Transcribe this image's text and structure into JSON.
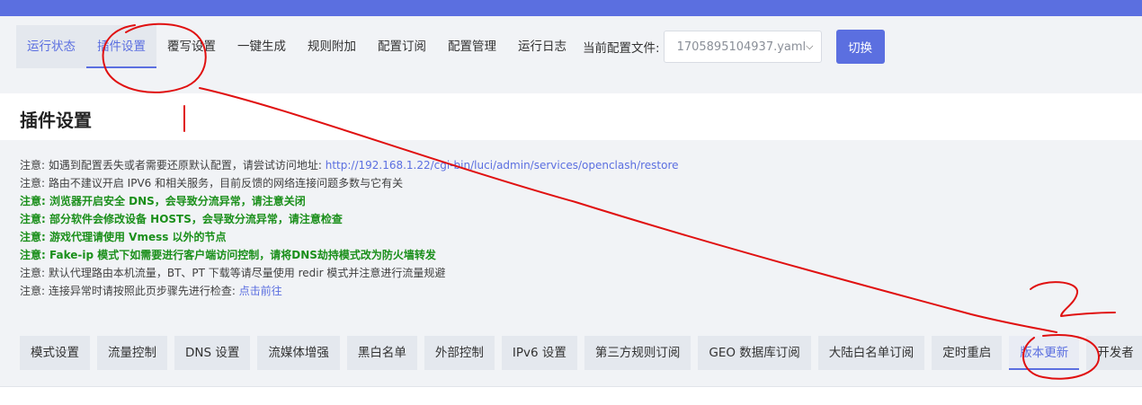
{
  "nav": {
    "tabs": [
      {
        "label": "运行状态"
      },
      {
        "label": "插件设置"
      },
      {
        "label": "覆写设置"
      },
      {
        "label": "一键生成"
      },
      {
        "label": "规则附加"
      },
      {
        "label": "配置订阅"
      },
      {
        "label": "配置管理"
      },
      {
        "label": "运行日志"
      }
    ],
    "config_label": "当前配置文件:",
    "config_value": "1705895104937.yaml",
    "switch_label": "切换"
  },
  "page": {
    "title": "插件设置"
  },
  "notes": [
    {
      "text": "注意: 如遇到配置丢失或者需要还原默认配置，请尝试访问地址: ",
      "link": "http://192.168.1.22/cgi-bin/luci/admin/services/openclash/restore"
    },
    {
      "text": "注意: 路由不建议开启 IPV6 和相关服务，目前反馈的网络连接问题多数与它有关"
    },
    {
      "text": "注意: 浏览器开启安全 DNS，会导致分流异常，请注意关闭"
    },
    {
      "text": "注意: 部分软件会修改设备 HOSTS，会导致分流异常，请注意检查"
    },
    {
      "text": "注意: 游戏代理请使用 Vmess 以外的节点"
    },
    {
      "text": "注意: Fake-ip 模式下如需要进行客户端访问控制，请将DNS劫持模式改为防火墙转发"
    },
    {
      "text": "注意: 默认代理路由本机流量，BT、PT 下载等请尽量使用 redir 模式并注意进行流量规避"
    },
    {
      "text": "注意: 连接异常时请按照此页步骤先进行检查: ",
      "link": "点击前往"
    }
  ],
  "subtabs": [
    {
      "label": "模式设置"
    },
    {
      "label": "流量控制"
    },
    {
      "label": "DNS 设置"
    },
    {
      "label": "流媒体增强"
    },
    {
      "label": "黑白名单"
    },
    {
      "label": "外部控制"
    },
    {
      "label": "IPv6 设置"
    },
    {
      "label": "第三方规则订阅"
    },
    {
      "label": "GEO 数据库订阅"
    },
    {
      "label": "大陆白名单订阅"
    },
    {
      "label": "定时重启"
    },
    {
      "label": "版本更新"
    },
    {
      "label": "开发者"
    }
  ],
  "colors": {
    "accent": "#5b6fe0",
    "note_green": "#1a8f1a",
    "annotation_red": "#e01010"
  }
}
